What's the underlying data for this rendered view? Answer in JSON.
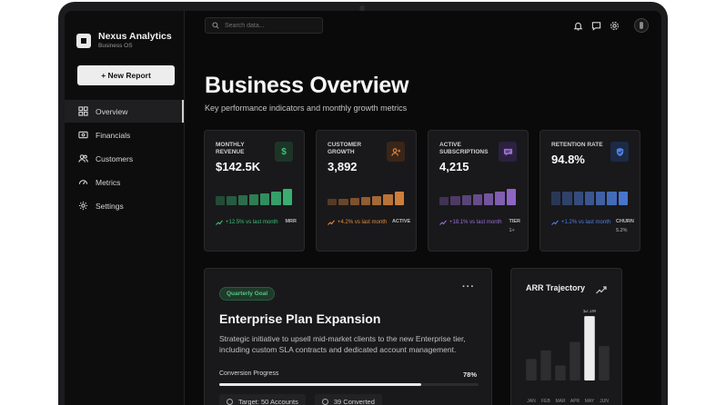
{
  "brand": {
    "name": "Nexus Analytics",
    "subtitle": "Business OS"
  },
  "sidebar": {
    "new_report_label": "+ New Report",
    "items": [
      {
        "label": "Overview",
        "icon": "grid-icon",
        "active": true
      },
      {
        "label": "Financials",
        "icon": "wallet-icon",
        "active": false
      },
      {
        "label": "Customers",
        "icon": "users-icon",
        "active": false
      },
      {
        "label": "Metrics",
        "icon": "gauge-icon",
        "active": false
      },
      {
        "label": "Settings",
        "icon": "gear-icon",
        "active": false
      }
    ]
  },
  "topbar": {
    "search_placeholder": "Search data...",
    "icons": [
      "bell-icon",
      "chat-icon",
      "gear-icon",
      "avatar"
    ]
  },
  "page": {
    "title": "Business Overview",
    "subtitle": "Key performance indicators and monthly growth metrics"
  },
  "cards": [
    {
      "label": "Monthly Revenue",
      "value": "$142.5K",
      "icon": "dollar-icon",
      "icon_glyph": "$",
      "accent": "#3dbf7a",
      "icon_bg": "#1d3527",
      "trend": "+12.5% vs last month",
      "tag": "MRR",
      "tag_sub": "",
      "bars": [
        0.5,
        0.5,
        0.55,
        0.6,
        0.65,
        0.75,
        0.9
      ]
    },
    {
      "label": "Customer Growth",
      "value": "3,892",
      "icon": "user-plus-icon",
      "icon_glyph": "",
      "accent": "#e28a3f",
      "icon_bg": "#3a2618",
      "trend": "+4.2% vs last month",
      "tag": "ACTIVE",
      "tag_sub": "",
      "bars": [
        0.35,
        0.35,
        0.4,
        0.45,
        0.5,
        0.6,
        0.75
      ]
    },
    {
      "label": "Active Subscriptions",
      "value": "4,215",
      "icon": "chat-card-icon",
      "icon_glyph": "",
      "accent": "#9a6fd6",
      "icon_bg": "#2c2140",
      "trend": "+18.1% vs last month",
      "tag": "TIER",
      "tag_sub": "1+",
      "bars": [
        0.45,
        0.5,
        0.55,
        0.6,
        0.65,
        0.75,
        0.9
      ]
    },
    {
      "label": "Retention Rate",
      "value": "94.8%",
      "icon": "shield-icon",
      "icon_glyph": "",
      "accent": "#4f7fe0",
      "icon_bg": "#1c2a45",
      "trend": "+1.2% vs last month",
      "tag": "CHURN",
      "tag_sub": "5.2%",
      "bars": [
        0.75,
        0.75,
        0.75,
        0.75,
        0.75,
        0.75,
        0.75
      ]
    }
  ],
  "goal": {
    "badge": "Quarterly Goal",
    "more_label": "···",
    "title": "Enterprise Plan Expansion",
    "description": "Strategic initiative to upsell mid-market clients to the new Enterprise tier, including custom SLA contracts and dedicated account management.",
    "progress_label": "Conversion Progress",
    "progress_pct_label": "78%",
    "progress_value": 0.78,
    "target_label": "Target: 50 Accounts",
    "converted_label": "39 Converted"
  },
  "arr": {
    "title": "ARR Trajectory",
    "highlight_label": "$2.1M"
  },
  "chart_data": {
    "type": "bar",
    "title": "ARR Trajectory",
    "categories": [
      "JAN",
      "FEB",
      "MAR",
      "APR",
      "MAY",
      "JUN"
    ],
    "values": [
      1.0,
      1.4,
      0.7,
      1.8,
      3.0,
      1.6
    ],
    "highlight_index": 4,
    "highlight_label": "$2.1M",
    "ylim": [
      0,
      3.3
    ]
  }
}
